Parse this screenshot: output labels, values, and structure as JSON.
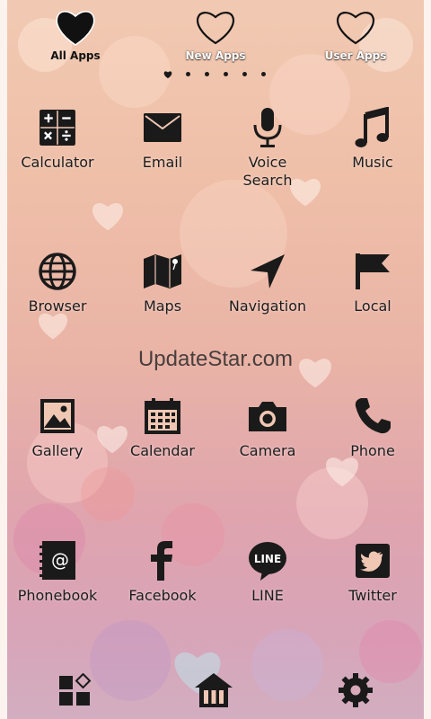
{
  "tabs": [
    {
      "label": "All Apps",
      "icon": "heart-filled-icon",
      "active": true
    },
    {
      "label": "New Apps",
      "icon": "heart-outline-icon",
      "active": false
    },
    {
      "label": "User Apps",
      "icon": "heart-outline-icon",
      "active": false
    }
  ],
  "page_indicator": {
    "pages": 6,
    "current": 1
  },
  "apps": [
    {
      "label": "Calculator",
      "icon": "calculator-icon"
    },
    {
      "label": "Email",
      "icon": "envelope-icon"
    },
    {
      "label": "Voice\nSearch",
      "icon": "microphone-icon"
    },
    {
      "label": "Music",
      "icon": "music-note-icon"
    },
    {
      "label": "Browser",
      "icon": "globe-icon"
    },
    {
      "label": "Maps",
      "icon": "folded-map-icon"
    },
    {
      "label": "Navigation",
      "icon": "navigation-arrow-icon"
    },
    {
      "label": "Local",
      "icon": "flag-icon"
    },
    {
      "label": "Gallery",
      "icon": "picture-icon"
    },
    {
      "label": "Calendar",
      "icon": "calendar-icon"
    },
    {
      "label": "Camera",
      "icon": "camera-icon"
    },
    {
      "label": "Phone",
      "icon": "phone-handset-icon"
    },
    {
      "label": "Phonebook",
      "icon": "address-book-icon"
    },
    {
      "label": "Facebook",
      "icon": "facebook-icon"
    },
    {
      "label": "LINE",
      "icon": "line-bubble-icon"
    },
    {
      "label": "Twitter",
      "icon": "twitter-bird-icon"
    }
  ],
  "watermark": "UpdateStar.com",
  "dock": [
    {
      "icon": "widgets-grid-icon"
    },
    {
      "icon": "home-icon"
    },
    {
      "icon": "settings-gear-icon"
    }
  ],
  "colors": {
    "icon": "#1a1a1a",
    "background_top": "#f1c9b2",
    "background_bottom": "#d2aec0"
  }
}
